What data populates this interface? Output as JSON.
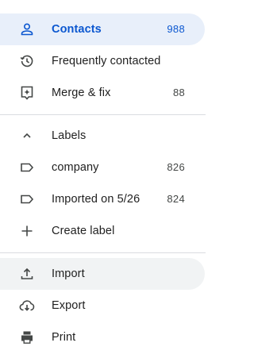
{
  "nav": {
    "contacts": {
      "label": "Contacts",
      "count": "988",
      "icon": "person-icon"
    },
    "frequent": {
      "label": "Frequently contacted",
      "icon": "history-icon"
    },
    "merge": {
      "label": "Merge & fix",
      "count": "88",
      "icon": "merge-fix-icon"
    }
  },
  "labels": {
    "heading": "Labels",
    "items": [
      {
        "label": "company",
        "count": "826",
        "icon": "label-icon"
      },
      {
        "label": "Imported on 5/26",
        "count": "824",
        "icon": "label-icon"
      }
    ],
    "create": "Create label"
  },
  "actions": {
    "import": "Import",
    "export": "Export",
    "print": "Print"
  },
  "colors": {
    "accent": "#0b57d0",
    "active_bg": "#e8effa",
    "hover_bg": "#f1f3f4",
    "icon": "#444746"
  }
}
